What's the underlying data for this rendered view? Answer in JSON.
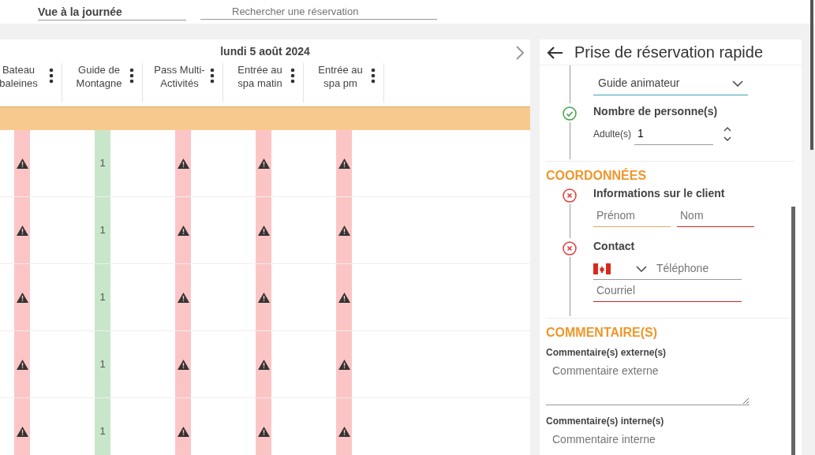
{
  "top_bar": {
    "view_select": {
      "value": "Vue à la journée"
    },
    "search": {
      "placeholder": "Rechercher une réservation"
    }
  },
  "schedule": {
    "date": "lundi 5 août 2024",
    "columns": [
      {
        "label": "Bateau baleines"
      },
      {
        "label": "Guide de Montagne"
      },
      {
        "label": "Pass Multi-Activités"
      },
      {
        "label": "Entrée au spa matin"
      },
      {
        "label": "Entrée au spa pm"
      }
    ],
    "rows": [
      {
        "cells": [
          {
            "kind": "warning"
          },
          {
            "kind": "count",
            "text": "1"
          },
          {
            "kind": "warning"
          },
          {
            "kind": "warning"
          },
          {
            "kind": "warning"
          }
        ]
      },
      {
        "cells": [
          {
            "kind": "warning"
          },
          {
            "kind": "count",
            "text": "1"
          },
          {
            "kind": "warning"
          },
          {
            "kind": "warning"
          },
          {
            "kind": "warning"
          }
        ]
      },
      {
        "cells": [
          {
            "kind": "warning"
          },
          {
            "kind": "count",
            "text": "1"
          },
          {
            "kind": "warning"
          },
          {
            "kind": "warning"
          },
          {
            "kind": "warning"
          }
        ]
      },
      {
        "cells": [
          {
            "kind": "warning"
          },
          {
            "kind": "count",
            "text": "1"
          },
          {
            "kind": "warning"
          },
          {
            "kind": "warning"
          },
          {
            "kind": "warning"
          }
        ]
      },
      {
        "cells": [
          {
            "kind": "warning"
          },
          {
            "kind": "count",
            "text": "1"
          },
          {
            "kind": "warning"
          },
          {
            "kind": "warning"
          },
          {
            "kind": "warning"
          }
        ]
      }
    ]
  },
  "panel": {
    "title": "Prise de réservation rapide",
    "guide_select": {
      "value": "Guide animateur"
    },
    "people_step": {
      "complete": true,
      "title": "Nombre de personne(s)",
      "label": "Adulte(s)",
      "value": "1"
    },
    "contact_section": "COORDONNÉES",
    "client_step": {
      "complete": false,
      "title": "Informations sur le client",
      "fields": [
        {
          "placeholder": "Prénom",
          "invalid": false
        },
        {
          "placeholder": "Nom",
          "invalid": true
        }
      ]
    },
    "contact_step": {
      "complete": false,
      "title": "Contact",
      "phone": {
        "placeholder": "Téléphone",
        "invalid": false
      },
      "email": {
        "placeholder": "Courriel",
        "invalid": true
      }
    },
    "comments_section": "COMMENTAIRE(S)",
    "comments": [
      {
        "label": "Commentaire(s) externe(s)",
        "placeholder": "Commentaire externe"
      },
      {
        "label": "Commentaire(s) interne(s)",
        "placeholder": "Commentaire interne"
      }
    ]
  }
}
